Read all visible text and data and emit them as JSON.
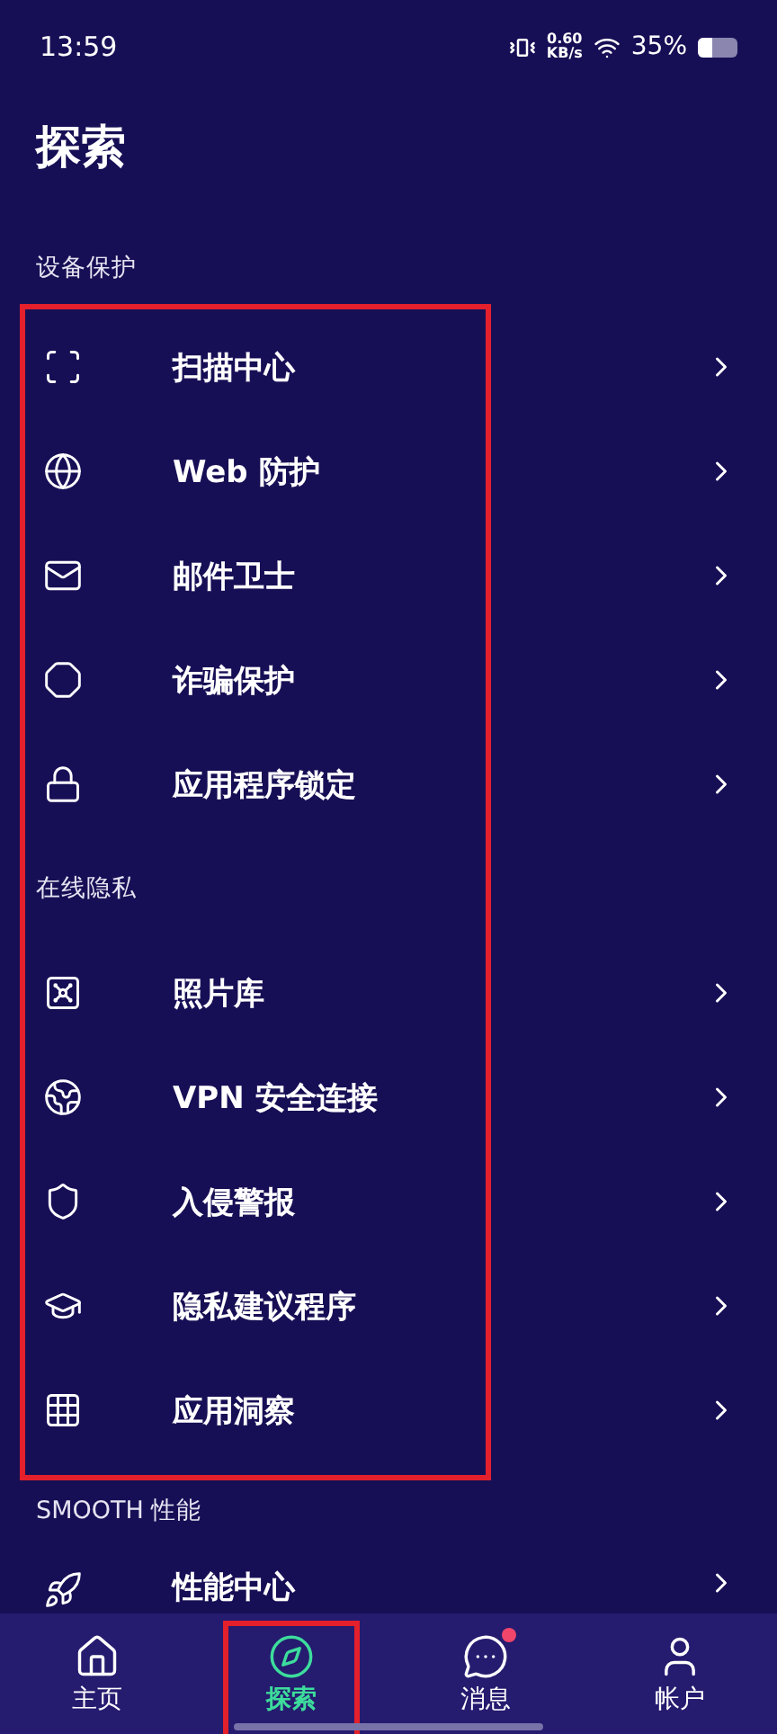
{
  "status_bar": {
    "time": "13:59",
    "net_speed": "0.60",
    "net_unit": "KB/s",
    "battery": "35%"
  },
  "title": "探索",
  "list_highlighted": true,
  "sections": [
    {
      "header": "设备保护",
      "rows": [
        {
          "label": "扫描中心"
        },
        {
          "label": "Web 防护"
        },
        {
          "label": "邮件卫士"
        },
        {
          "label": "诈骗保护"
        },
        {
          "label": "应用程序锁定"
        }
      ]
    },
    {
      "header": "在线隐私",
      "rows": [
        {
          "label": "照片库"
        },
        {
          "label": "VPN 安全连接"
        },
        {
          "label": "入侵警报"
        },
        {
          "label": "隐私建议程序"
        },
        {
          "label": "应用洞察"
        }
      ]
    },
    {
      "header": "SMOOTH 性能",
      "rows": [
        {
          "label": "性能中心"
        }
      ]
    }
  ],
  "nav": [
    {
      "label": "主页",
      "selected": false,
      "badge": false,
      "highlighted": false
    },
    {
      "label": "探索",
      "selected": true,
      "badge": false,
      "highlighted": true
    },
    {
      "label": "消息",
      "selected": false,
      "badge": true,
      "highlighted": false
    },
    {
      "label": "帐户",
      "selected": false,
      "badge": false,
      "highlighted": false
    }
  ]
}
